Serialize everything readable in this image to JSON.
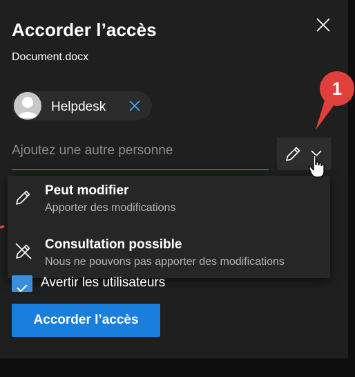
{
  "dialog": {
    "title": "Accorder l’accès",
    "filename": "Document.docx"
  },
  "recipient": {
    "name": "Helpdesk"
  },
  "add_person": {
    "placeholder": "Ajoutez une autre personne"
  },
  "annotation": {
    "step_number": "1",
    "color": "#e0403c"
  },
  "permission_menu": {
    "items": [
      {
        "title": "Peut modifier",
        "description": "Apporter des modifications",
        "icon": "pencil-icon"
      },
      {
        "title": "Consultation possible",
        "description": "Nous ne pouvons pas apporter des modifications",
        "icon": "pencil-off-icon"
      }
    ]
  },
  "notify": {
    "label": "Avertir les utilisateurs",
    "checked": true
  },
  "actions": {
    "grant_label": "Accorder l’accès"
  },
  "colors": {
    "accent": "#1a7fdc",
    "background": "#1f1f1f",
    "annotation": "#e0403c"
  }
}
